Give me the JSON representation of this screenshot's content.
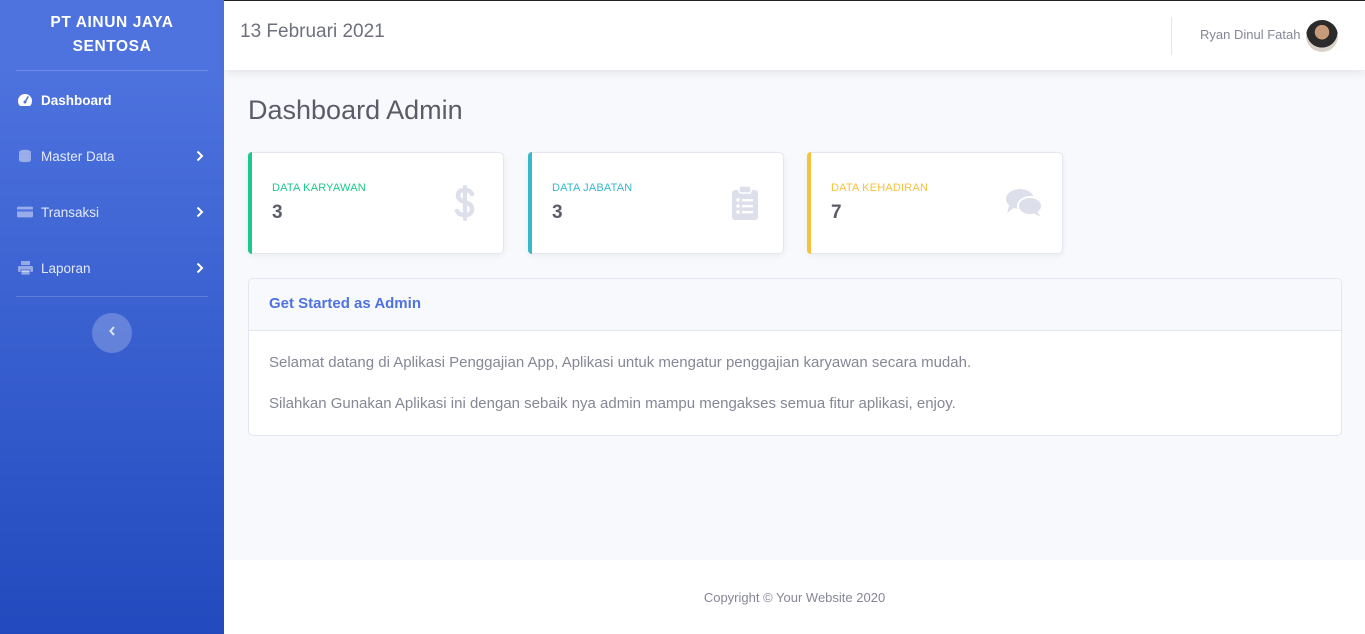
{
  "sidebar": {
    "brand": "PT AINUN JAYA SENTOSA",
    "items": [
      {
        "label": "Dashboard",
        "icon": "tachometer-icon",
        "active": true
      },
      {
        "label": "Master Data",
        "icon": "database-icon",
        "active": false
      },
      {
        "label": "Transaksi",
        "icon": "credit-card-icon",
        "active": false
      },
      {
        "label": "Laporan",
        "icon": "print-icon",
        "active": false
      }
    ],
    "toggle_icon": "chevron-left-icon"
  },
  "topbar": {
    "date": "13 Februari 2021",
    "user_name": "Ryan Dinul Fatah"
  },
  "main": {
    "title": "Dashboard Admin",
    "cards": [
      {
        "label": "DATA KARYAWAN",
        "value": "3",
        "color": "#1cc88a",
        "icon": "dollar-icon"
      },
      {
        "label": "DATA JABATAN",
        "value": "3",
        "color": "#36b9cc",
        "icon": "clipboard-list-icon"
      },
      {
        "label": "DATA KEHADIRAN",
        "value": "7",
        "color": "#f6c23e",
        "icon": "comments-icon"
      }
    ],
    "panel": {
      "title": "Get Started as Admin",
      "paragraphs": [
        "Selamat datang di Aplikasi Penggajian App, Aplikasi untuk mengatur penggajian karyawan secara mudah.",
        "Silahkan Gunakan Aplikasi ini dengan sebaik nya admin mampu mengakses semua fitur aplikasi, enjoy."
      ]
    }
  },
  "footer": {
    "copyright": "Copyright © Your Website 2020"
  },
  "colors": {
    "primary": "#4e73df",
    "success": "#1cc88a",
    "info": "#36b9cc",
    "warning": "#f6c23e"
  }
}
